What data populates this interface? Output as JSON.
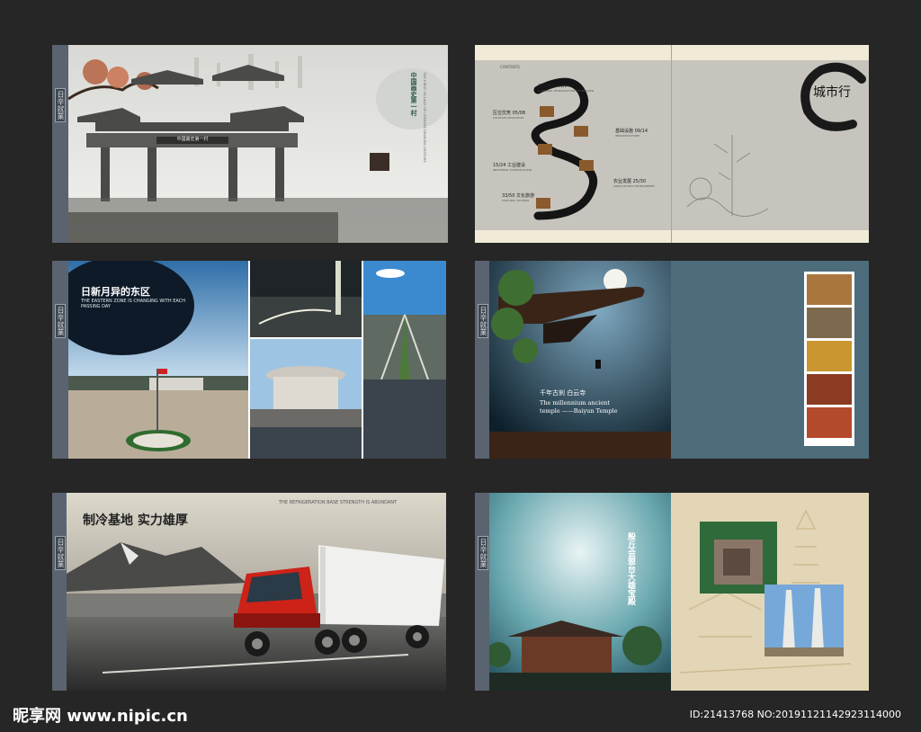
{
  "spread1": {
    "tab_label": "日辛就業",
    "gate_plaque": "中國畫史第一村",
    "headline_vertical": "中国画史第一村",
    "english_title": "THE FIRST VILLAGE OF CHINESE DRAWING HISTORY"
  },
  "spread2": {
    "contents_label": "CONTENTS",
    "toc": [
      {
        "title": "河权概况 01/04",
        "sub": "A GENERAL INTRODUCTION OF HESQUEN"
      },
      {
        "title": "区位优势 05/08",
        "sub": "LOCATION ADVANTAGE"
      },
      {
        "title": "基础设施 09/14",
        "sub": "INFRASTRUCTURE"
      },
      {
        "title": "15/24 工业建设",
        "sub": "INDUSTRIAL CONSTRUCTION"
      },
      {
        "title": "农业发展 25/30",
        "sub": "AGRICULTURAL DEVELOPMENT"
      },
      {
        "title": "33/50 文化旅游",
        "sub": "CULTURAL TOURISM"
      }
    ],
    "seal_text": "城市行"
  },
  "spread3": {
    "tab_label": "日辛就業",
    "headline": "日新月异的东区",
    "subheadline": "THE EASTERN ZONE IS CHANGING WITH EACH PASSING DAY"
  },
  "spread4": {
    "tab_label": "日辛就業",
    "title_cn": "千年古刹 白云寺",
    "title_en_1": "The millennium ancient",
    "title_en_2": "temple ——Baiyun Temple"
  },
  "spread5": {
    "tab_label": "日辛就業",
    "headline": "制冷基地  实力雄厚",
    "english_title": "THE REFRIGERATION BASE STRENGTH IS ABUNDANT"
  },
  "spread6": {
    "tab_label": "日辛就業",
    "title_vertical": "殷丘会盟台大雄宝殿"
  },
  "footer": {
    "site": "昵享网 www.nipic.cn",
    "id": "ID:21413768 NO:20191121142923114000"
  },
  "colors": {
    "background": "#262626",
    "teal": "#4d6c7c",
    "beige": "#e3d6b6"
  }
}
